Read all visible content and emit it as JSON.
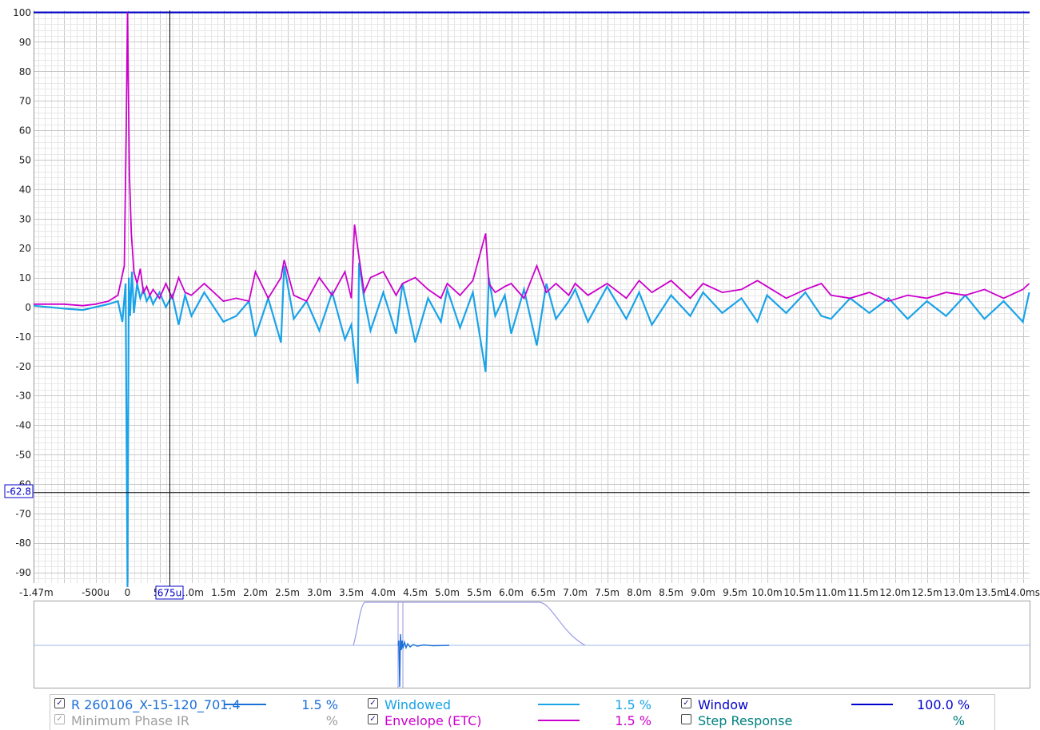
{
  "chart_data": {
    "type": "line",
    "title": "",
    "xlabel": "",
    "ylabel": "",
    "xlim": [
      -1.47,
      14.1
    ],
    "ylim": [
      -95,
      100
    ],
    "x_unit": "ms",
    "x_tick_labels": [
      {
        "v": -1.47,
        "t": "-1.47m"
      },
      {
        "v": -0.5,
        "t": "-500u"
      },
      {
        "v": 0,
        "t": "0"
      },
      {
        "v": 0.5,
        "t": "50"
      },
      {
        "v": 1.0,
        "t": "1.0m"
      },
      {
        "v": 1.5,
        "t": "1.5m"
      },
      {
        "v": 2.0,
        "t": "2.0m"
      },
      {
        "v": 2.5,
        "t": "2.5m"
      },
      {
        "v": 3.0,
        "t": "3.0m"
      },
      {
        "v": 3.5,
        "t": "3.5m"
      },
      {
        "v": 4.0,
        "t": "4.0m"
      },
      {
        "v": 4.5,
        "t": "4.5m"
      },
      {
        "v": 5.0,
        "t": "5.0m"
      },
      {
        "v": 5.5,
        "t": "5.5m"
      },
      {
        "v": 6.0,
        "t": "6.0m"
      },
      {
        "v": 6.5,
        "t": "6.5m"
      },
      {
        "v": 7.0,
        "t": "7.0m"
      },
      {
        "v": 7.5,
        "t": "7.5m"
      },
      {
        "v": 8.0,
        "t": "8.0m"
      },
      {
        "v": 8.5,
        "t": "8.5m"
      },
      {
        "v": 9.0,
        "t": "9.0m"
      },
      {
        "v": 9.5,
        "t": "9.5m"
      },
      {
        "v": 10.0,
        "t": "10.0m"
      },
      {
        "v": 10.5,
        "t": "10.5m"
      },
      {
        "v": 11.0,
        "t": "11.0m"
      },
      {
        "v": 11.5,
        "t": "11.5m"
      },
      {
        "v": 12.0,
        "t": "12.0m"
      },
      {
        "v": 12.5,
        "t": "12.5m"
      },
      {
        "v": 13.0,
        "t": "13.0m"
      },
      {
        "v": 13.5,
        "t": "13.5m"
      },
      {
        "v": 14.0,
        "t": "14.0ms"
      }
    ],
    "y_ticks": [
      100,
      90,
      80,
      70,
      60,
      50,
      40,
      30,
      20,
      10,
      0,
      -10,
      -20,
      -30,
      -40,
      -50,
      -60,
      -70,
      -80,
      -90
    ],
    "grid": true,
    "cursor": {
      "x_label": "675u",
      "y_label": "-62.8"
    },
    "window_level": 100,
    "series": [
      {
        "name": "Envelope (ETC)",
        "color": "#cc00cc",
        "x": [
          -1.47,
          -1.0,
          -0.7,
          -0.5,
          -0.3,
          -0.15,
          -0.05,
          -0.02,
          0.0,
          0.03,
          0.06,
          0.1,
          0.15,
          0.2,
          0.25,
          0.3,
          0.35,
          0.4,
          0.5,
          0.6,
          0.7,
          0.8,
          0.9,
          1.0,
          1.2,
          1.5,
          1.7,
          1.9,
          2.0,
          2.2,
          2.4,
          2.45,
          2.6,
          2.8,
          3.0,
          3.2,
          3.4,
          3.5,
          3.55,
          3.62,
          3.7,
          3.8,
          4.0,
          4.2,
          4.3,
          4.5,
          4.7,
          4.9,
          5.0,
          5.2,
          5.4,
          5.6,
          5.65,
          5.75,
          5.9,
          6.0,
          6.2,
          6.4,
          6.55,
          6.7,
          6.9,
          7.0,
          7.2,
          7.5,
          7.8,
          8.0,
          8.2,
          8.5,
          8.8,
          9.0,
          9.3,
          9.6,
          9.85,
          10.0,
          10.3,
          10.6,
          10.85,
          11.0,
          11.3,
          11.6,
          11.9,
          12.2,
          12.5,
          12.8,
          13.1,
          13.4,
          13.7,
          14.0,
          14.1
        ],
        "values": [
          1,
          1,
          0.5,
          1,
          2,
          4,
          14,
          60,
          100,
          45,
          25,
          12,
          8,
          13,
          5,
          7,
          4,
          6,
          3,
          8,
          3,
          10,
          5,
          4,
          8,
          2,
          3,
          2,
          12,
          3,
          10,
          16,
          4,
          2,
          10,
          4,
          12,
          3,
          28,
          17,
          5,
          10,
          12,
          4,
          8,
          10,
          6,
          3,
          8,
          4,
          9,
          25,
          8,
          5,
          7,
          8,
          3,
          14,
          5,
          8,
          4,
          8,
          4,
          8,
          3,
          9,
          5,
          9,
          3,
          8,
          5,
          6,
          9,
          7,
          3,
          6,
          8,
          4,
          3,
          5,
          2,
          4,
          3,
          5,
          4,
          6,
          3,
          6,
          8
        ]
      },
      {
        "name": "Windowed",
        "color": "#1aa3e8",
        "x": [
          -1.47,
          -1.0,
          -0.7,
          -0.5,
          -0.3,
          -0.15,
          -0.08,
          -0.03,
          0.0,
          0.02,
          0.04,
          0.07,
          0.1,
          0.15,
          0.2,
          0.25,
          0.3,
          0.35,
          0.4,
          0.5,
          0.6,
          0.7,
          0.8,
          0.9,
          1.0,
          1.2,
          1.5,
          1.7,
          1.9,
          2.0,
          2.2,
          2.4,
          2.45,
          2.6,
          2.8,
          3.0,
          3.2,
          3.4,
          3.5,
          3.6,
          3.62,
          3.7,
          3.8,
          4.0,
          4.2,
          4.3,
          4.5,
          4.7,
          4.9,
          5.0,
          5.2,
          5.4,
          5.6,
          5.65,
          5.75,
          5.9,
          6.0,
          6.2,
          6.4,
          6.55,
          6.7,
          6.9,
          7.0,
          7.2,
          7.5,
          7.8,
          8.0,
          8.2,
          8.5,
          8.8,
          9.0,
          9.3,
          9.6,
          9.85,
          10.0,
          10.3,
          10.6,
          10.85,
          11.0,
          11.3,
          11.6,
          11.9,
          12.2,
          12.5,
          12.8,
          13.1,
          13.4,
          13.7,
          14.0,
          14.1
        ],
        "values": [
          0.5,
          -0.5,
          -1,
          0,
          1,
          2,
          -5,
          8,
          -95,
          10,
          -3,
          12,
          -2,
          8,
          3,
          6,
          2,
          4,
          1,
          5,
          0,
          4,
          -6,
          4,
          -3,
          5,
          -5,
          -3,
          2,
          -10,
          3,
          -12,
          14,
          -4,
          2,
          -8,
          5,
          -11,
          -6,
          -26,
          15,
          3,
          -8,
          5,
          -9,
          8,
          -12,
          3,
          -5,
          6,
          -7,
          5,
          -22,
          10,
          -3,
          4,
          -9,
          6,
          -13,
          8,
          -4,
          2,
          6,
          -5,
          7,
          -4,
          5,
          -6,
          4,
          -3,
          5,
          -2,
          3,
          -5,
          4,
          -2,
          5,
          -3,
          -4,
          3,
          -2,
          3,
          -4,
          2,
          -3,
          4,
          -4,
          2,
          -5,
          5
        ]
      }
    ]
  },
  "legend": {
    "items": [
      {
        "label": "R 260106_X-15-120_701.4",
        "value": "1.5 %",
        "color": "#1a6fd8",
        "checked": true,
        "enabled": true
      },
      {
        "label": "Windowed",
        "value": "1.5 %",
        "color": "#1aa3e8",
        "checked": true,
        "enabled": true
      },
      {
        "label": "Window",
        "value": "100.0 %",
        "color": "#0000cc",
        "checked": true,
        "enabled": true
      },
      {
        "label": "Minimum Phase IR",
        "value": "%",
        "color": "#a0a0a0",
        "checked": true,
        "enabled": false
      },
      {
        "label": "Envelope (ETC)",
        "value": "1.5 %",
        "color": "#cc00cc",
        "checked": true,
        "enabled": true
      },
      {
        "label": "Step Response",
        "value": "%",
        "color": "#008080",
        "checked": false,
        "enabled": true
      }
    ]
  }
}
